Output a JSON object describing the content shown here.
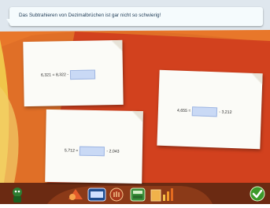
{
  "speech": {
    "text": "Das Subtrahieren von Dezimalbrüchen ist gar nicht so schwierig!"
  },
  "cards": [
    {
      "left": "6,321 = 8,322 -",
      "right": ""
    },
    {
      "left": "4,655 =",
      "right": "- 3,212"
    },
    {
      "left": "5,712 =",
      "right": "- 2,043"
    }
  ],
  "toolbar": {
    "items": [
      "shapes-icon",
      "number-grid-icon",
      "hand-icon",
      "calculator-icon",
      "folder-chart-icon"
    ],
    "check": "check-icon"
  },
  "colors": {
    "orange": "#e8772a",
    "red": "#cf3a1d",
    "yellow": "#f0c64a",
    "paper": "#fbfbf7",
    "blank": "#c9d9f5"
  }
}
